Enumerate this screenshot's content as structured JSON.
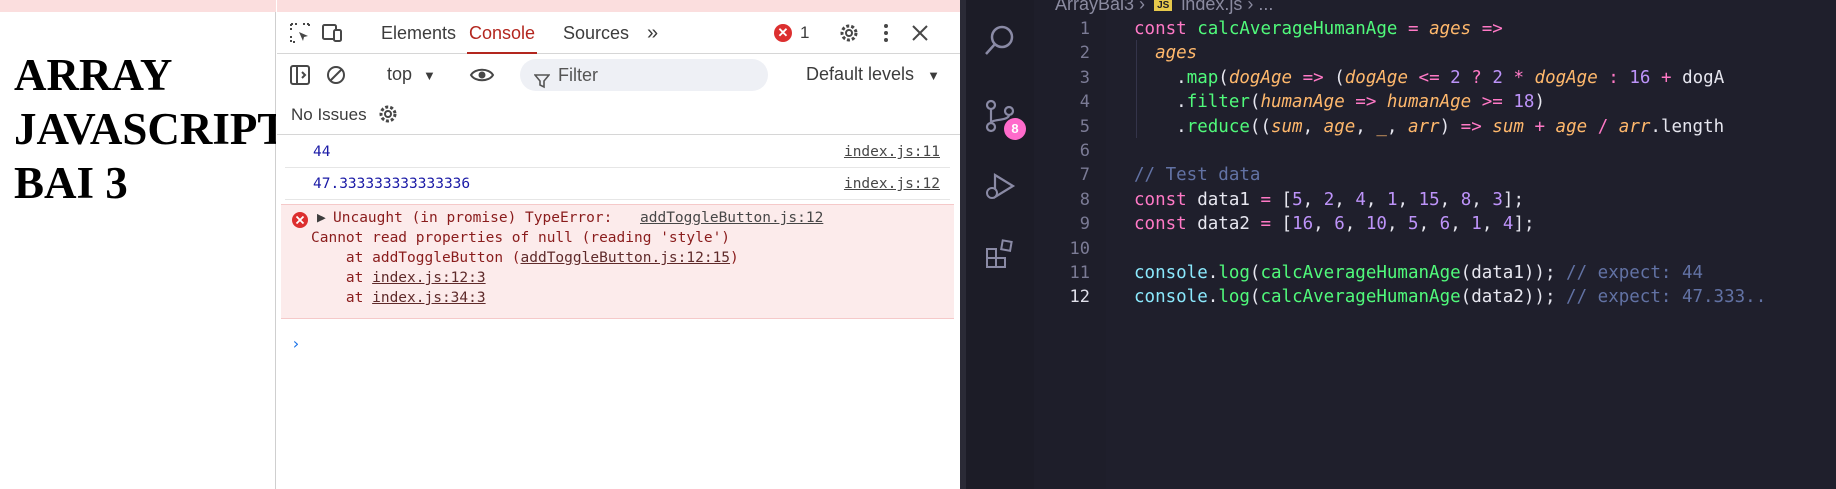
{
  "page": {
    "heading_lines": [
      "ARRAY",
      "JAVASCRIPT",
      "BAI 3"
    ]
  },
  "devtools": {
    "tabs": [
      "Elements",
      "Console",
      "Sources"
    ],
    "active_tab": "Console",
    "more_tabs_symbol": "»",
    "error_count": "1",
    "context": "top",
    "filter_placeholder": "Filter",
    "levels": "Default levels",
    "issues": "No Issues",
    "logs": [
      {
        "value": "44",
        "source": "index.js:11"
      },
      {
        "value": "47.333333333333336",
        "source": "index.js:12"
      }
    ],
    "error": {
      "message": "Uncaught (in promise) TypeError:",
      "source": "addToggleButton.js:12",
      "detail": "Cannot read properties of null (reading 'style')",
      "stack1_prefix": "    at addToggleButton (",
      "stack1_link": "addToggleButton.js:12:15",
      "stack1_suffix": ")",
      "stack2_prefix": "    at ",
      "stack2_link": "index.js:12:3",
      "stack3_prefix": "    at ",
      "stack3_link": "index.js:34:3"
    },
    "prompt": "›"
  },
  "vscode": {
    "breadcrumb_folder": "ArrayBai3",
    "breadcrumb_sep": "›",
    "breadcrumb_badge": "JS",
    "breadcrumb_file": "index.js",
    "breadcrumb_more": "› ...",
    "source_control_badge": "8",
    "line_numbers": [
      "1",
      "2",
      "3",
      "4",
      "5",
      "6",
      "7",
      "8",
      "9",
      "10",
      "11",
      "12"
    ],
    "current_line": "12",
    "code_lines": [
      "const calcAverageHumanAge = ages =>",
      "  ages",
      "    .map(dogAge => (dogAge <= 2 ? 2 * dogAge : 16 + dogA",
      "    .filter(humanAge => humanAge >= 18)",
      "    .reduce((sum, age, _, arr) => sum + age / arr.length",
      "",
      "// Test data",
      "const data1 = [5, 2, 4, 1, 15, 8, 3];",
      "const data2 = [16, 6, 10, 5, 6, 1, 4];",
      "",
      "console.log(calcAverageHumanAge(data1)); // expect: 44",
      "console.log(calcAverageHumanAge(data2)); // expect: 47.333.."
    ]
  },
  "colors": {
    "devtools_accent": "#b3261e",
    "error_bg": "#fcebeb",
    "editor_bg": "#1f1f2c",
    "keyword": "#ff79c6",
    "function": "#50fa7b",
    "param": "#ffb86c",
    "number": "#bd93f9",
    "comment": "#6272a4"
  }
}
